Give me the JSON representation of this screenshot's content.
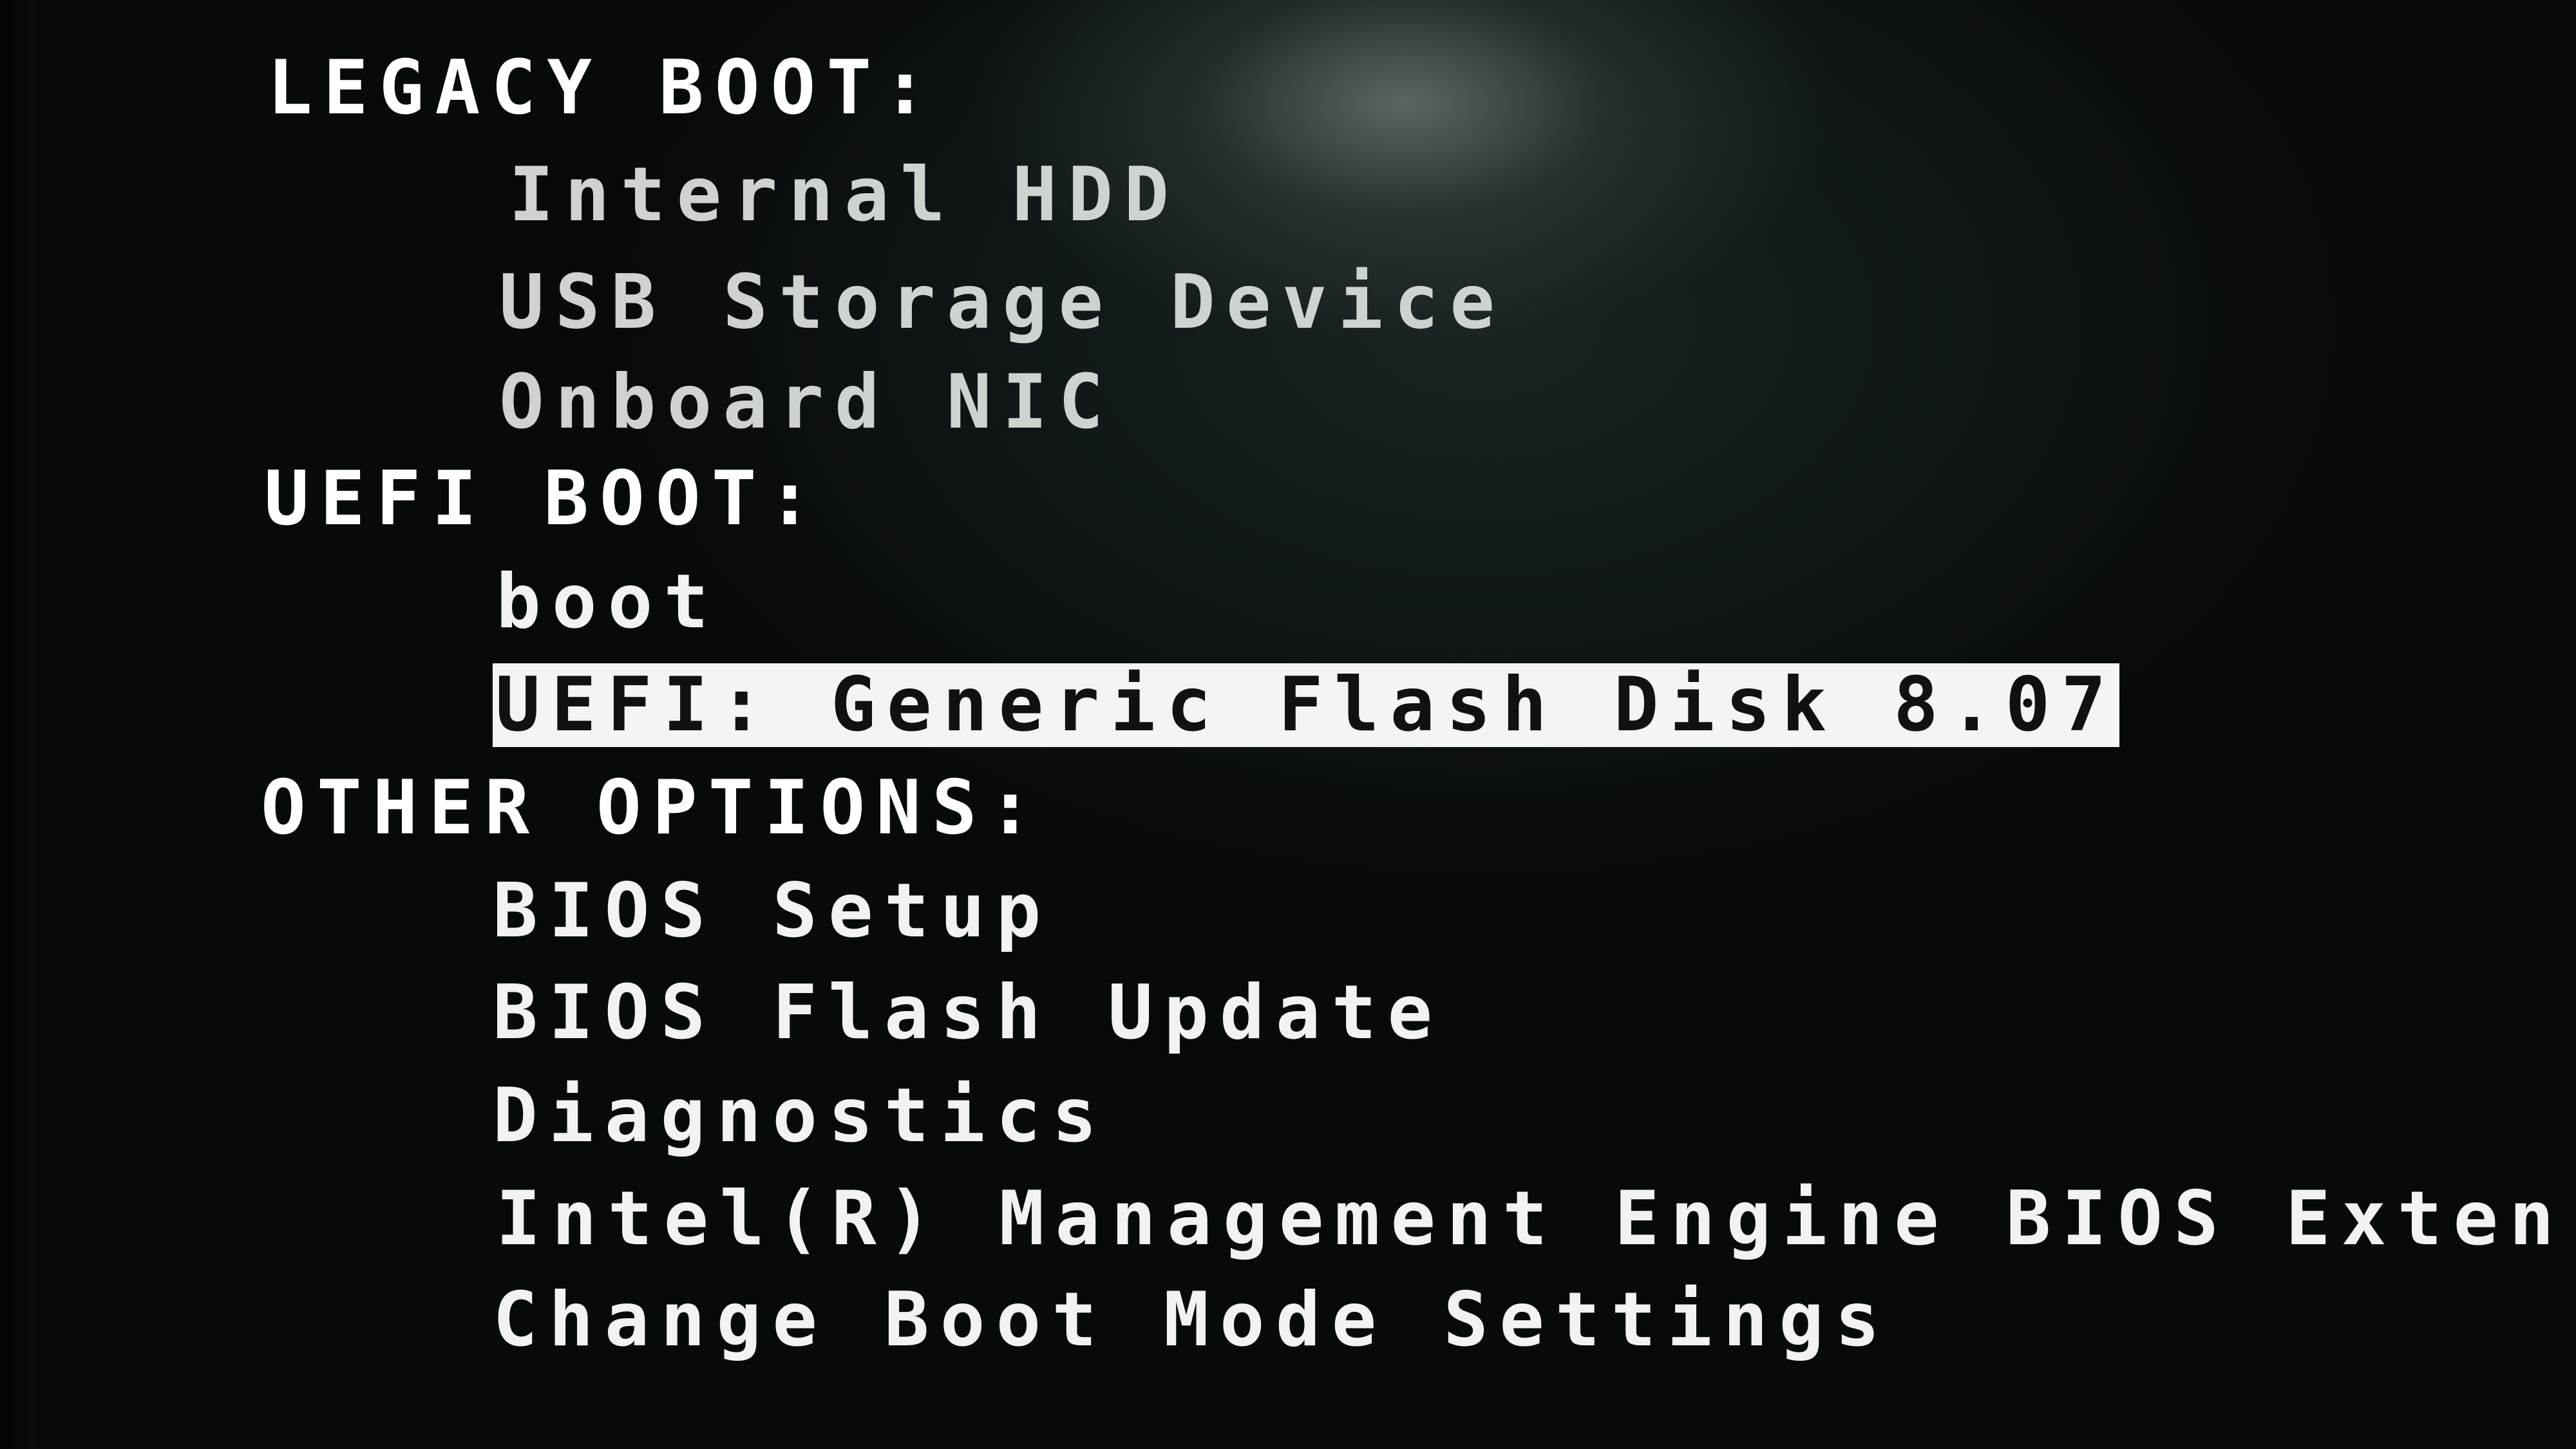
{
  "legacy_boot": {
    "header": "LEGACY BOOT:",
    "items": [
      "Internal HDD",
      "USB Storage Device",
      "Onboard NIC"
    ]
  },
  "uefi_boot": {
    "header": "UEFI BOOT:",
    "items": [
      "boot",
      "UEFI: Generic Flash Disk 8.07"
    ],
    "selected": "UEFI: Generic Flash Disk 8.07"
  },
  "other_options": {
    "header": "OTHER OPTIONS:",
    "items": [
      "BIOS Setup",
      "BIOS Flash Update",
      "Diagnostics",
      "Intel(R) Management Engine BIOS Exten",
      "Change Boot Mode Settings"
    ]
  },
  "colors": {
    "background": "#0b1011",
    "text": "#f2f2f2",
    "selection_background": "#f4f4f2",
    "selection_text": "#111111"
  }
}
